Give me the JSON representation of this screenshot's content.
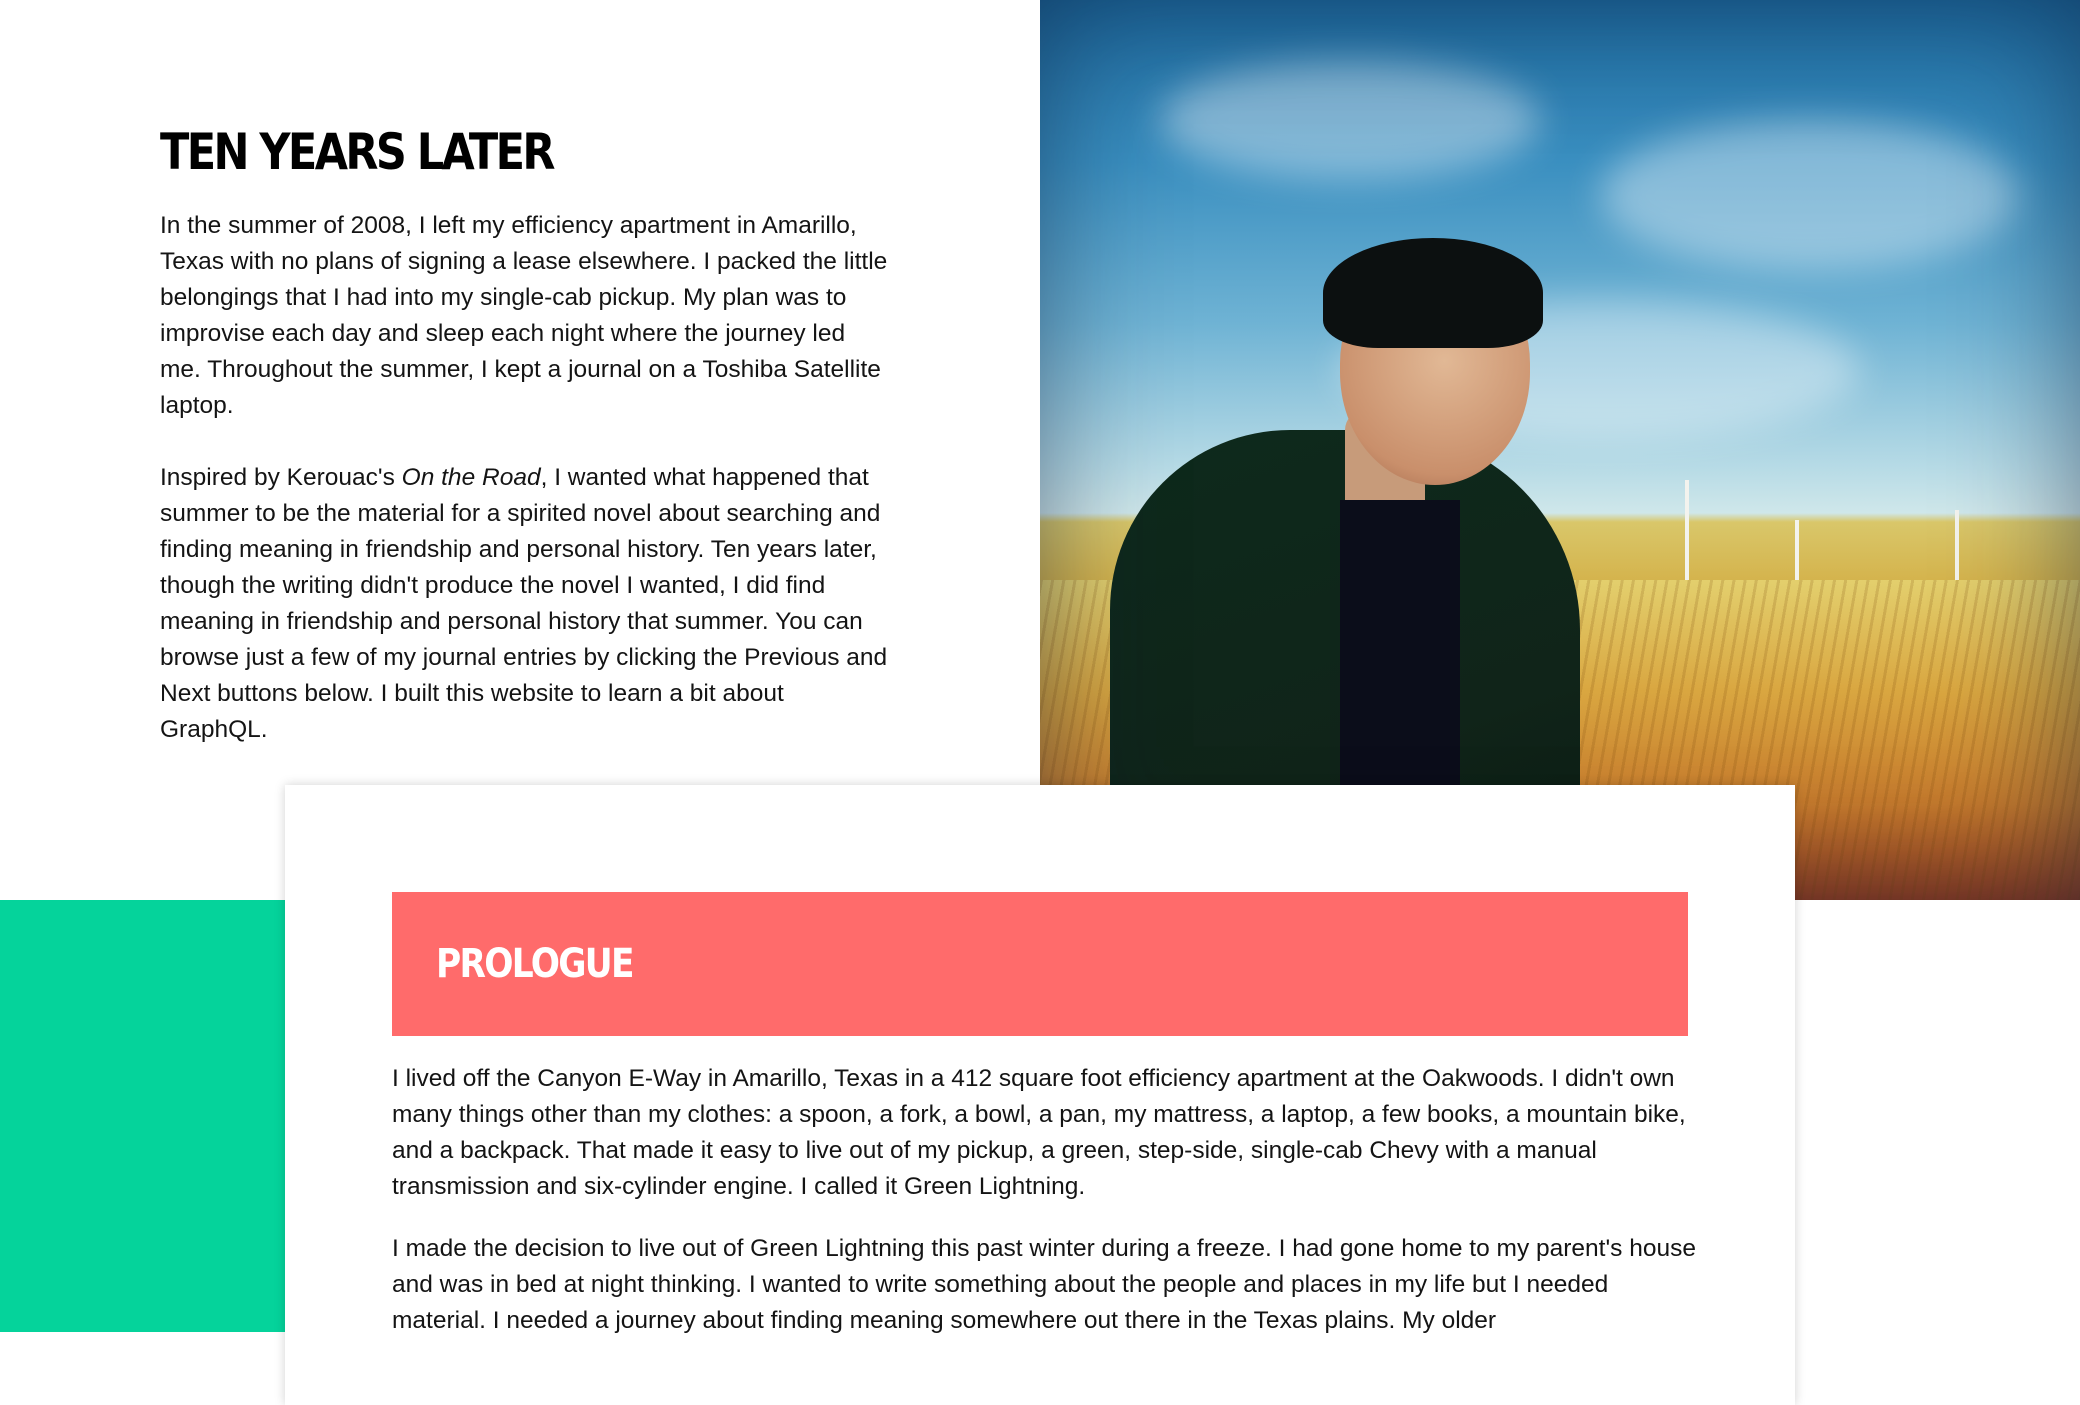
{
  "intro": {
    "title": "Ten Years Later",
    "paragraph1": "In the summer of 2008, I left my efficiency apartment in Amarillo, Texas with no plans of signing a lease elsewhere. I packed the little belongings that I had into my single-cab pickup. My plan was to improvise each day and sleep each night where the journey led me. Throughout the summer, I kept a journal on a Toshiba Satellite laptop.",
    "paragraph2_before": "Inspired by Kerouac's ",
    "paragraph2_book": "On the Road",
    "paragraph2_after": ", I wanted what happened that summer to be the material for a spirited novel about searching and finding meaning in friendship and personal history. Ten years later, though the writing didn't produce the novel I wanted, I did find meaning in friendship and personal history that summer. You can browse just a few of my journal entries by clicking the Previous and Next buttons below. I built this website to learn a bit about GraphQL."
  },
  "journal": {
    "chapter_title": "Prologue",
    "paragraphs": [
      "I lived off the Canyon E-Way in Amarillo, Texas in a 412 square foot efficiency apartment at the Oakwoods. I didn't own many things other than my clothes: a spoon, a fork, a bowl, a pan, my mattress, a laptop, a few books, a mountain bike, and a backpack. That made it easy to live out of my pickup, a green, step-side, single-cab Chevy with a manual transmission and six-cylinder engine. I called it Green Lightning.",
      "I made the decision to live out of Green Lightning this past winter during a freeze. I had gone home to my parent's house and was in bed at night thinking. I wanted to write something about the people and places in my life but I needed material. I needed a journey about finding meaning somewhere out there in the Texas plains. My older"
    ]
  },
  "colors": {
    "accent_green": "#05d39b",
    "chapter_banner": "#ff6b6b",
    "text": "#141414"
  }
}
